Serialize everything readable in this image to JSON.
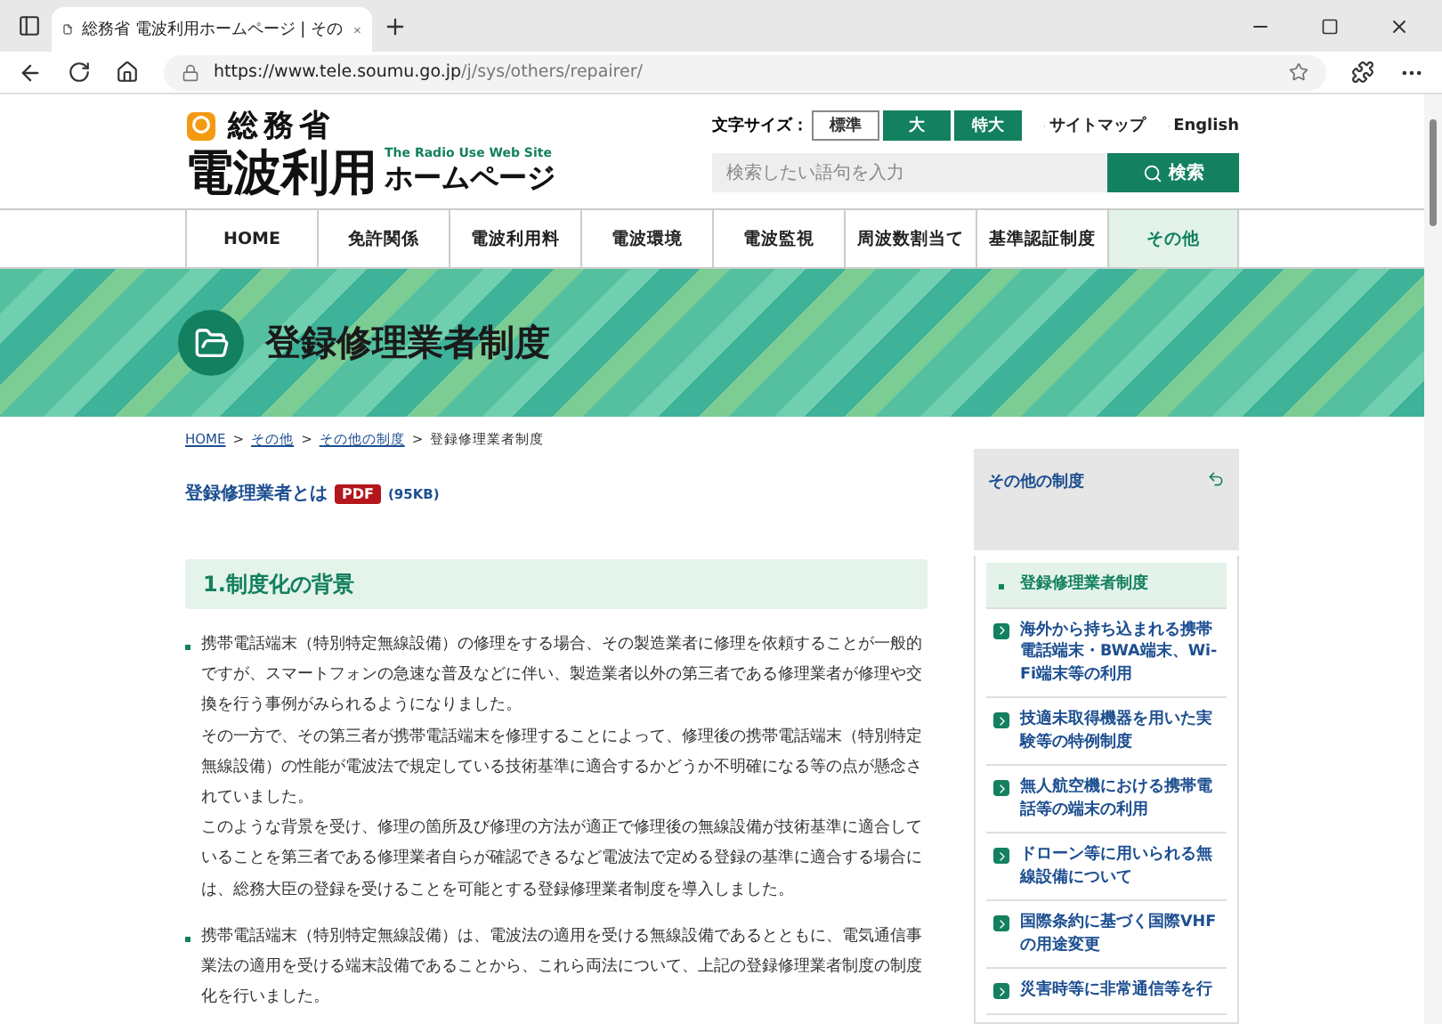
{
  "browser": {
    "tab_title": "総務省 電波利用ホームページ | その",
    "url_host": "https://www.tele.soumu.go.jp",
    "url_path": "/j/sys/others/repairer/"
  },
  "header": {
    "ministry": "総務省",
    "site_title": "電波利用",
    "site_subtitle": "ホームページ",
    "site_english": "The Radio Use Web Site",
    "font_size_label": "文字サイズ：",
    "font_sizes": [
      {
        "label": "標準",
        "selected": true
      },
      {
        "label": "大",
        "selected": false
      },
      {
        "label": "特大",
        "selected": false
      }
    ],
    "links": [
      "サイトマップ",
      "English"
    ],
    "search": {
      "placeholder": "検索したい語句を入力",
      "button": "検索"
    }
  },
  "nav": [
    {
      "label": "HOME",
      "selected": false
    },
    {
      "label": "免許関係",
      "selected": false
    },
    {
      "label": "電波利用料",
      "selected": false
    },
    {
      "label": "電波環境",
      "selected": false
    },
    {
      "label": "電波監視",
      "selected": false
    },
    {
      "label": "周波数割当て",
      "selected": false
    },
    {
      "label": "基準認証制度",
      "selected": false
    },
    {
      "label": "その他",
      "selected": true
    }
  ],
  "banner": {
    "title": "登録修理業者制度"
  },
  "breadcrumb_separator": ">",
  "breadcrumb": [
    {
      "label": "HOME",
      "link": true
    },
    {
      "label": "その他",
      "link": true
    },
    {
      "label": "その他の制度",
      "link": true
    },
    {
      "label": "登録修理業者制度",
      "link": false
    }
  ],
  "pdf_link": {
    "label": "登録修理業者とは",
    "badge": "PDF",
    "size": "(95KB)"
  },
  "section": {
    "heading": "1.制度化の背景",
    "bullets": [
      [
        "携帯電話端末（特別特定無線設備）の修理をする場合、その製造業者に修理を依頼することが一般的ですが、スマートフォンの急速な普及などに伴い、製造業者以外の第三者である修理業者が修理や交換を行う事例がみられるようになりました。",
        "その一方で、その第三者が携帯電話端末を修理することによって、修理後の携帯電話端末（特別特定無線設備）の性能が電波法で規定している技術基準に適合するかどうか不明確になる等の点が懸念されていました。",
        "このような背景を受け、修理の箇所及び修理の方法が適正で修理後の無線設備が技術基準に適合していることを第三者である修理業者自らが確認できるなど電波法で定める登録の基準に適合する場合には、総務大臣の登録を受けることを可能とする登録修理業者制度を導入しました。"
      ],
      [
        "携帯電話端末（特別特定無線設備）は、電波法の適用を受ける無線設備であるとともに、電気通信事業法の適用を受ける端末設備であることから、これら両法について、上記の登録修理業者制度の制度化を行いました。"
      ]
    ]
  },
  "sidebar": {
    "title": "その他の制度",
    "items": [
      {
        "label": "登録修理業者制度",
        "selected": true
      },
      {
        "label": "海外から持ち込まれる携帯電話端末・BWA端末、Wi-Fi端末等の利用",
        "selected": false
      },
      {
        "label": "技適未取得機器を用いた実験等の特例制度",
        "selected": false
      },
      {
        "label": "無人航空機における携帯電話等の端末の利用",
        "selected": false
      },
      {
        "label": "ドローン等に用いられる無線設備について",
        "selected": false
      },
      {
        "label": "国際条約に基づく国際VHFの用途変更",
        "selected": false
      },
      {
        "label": "災害時等に非常通信等を行",
        "selected": false
      }
    ]
  }
}
